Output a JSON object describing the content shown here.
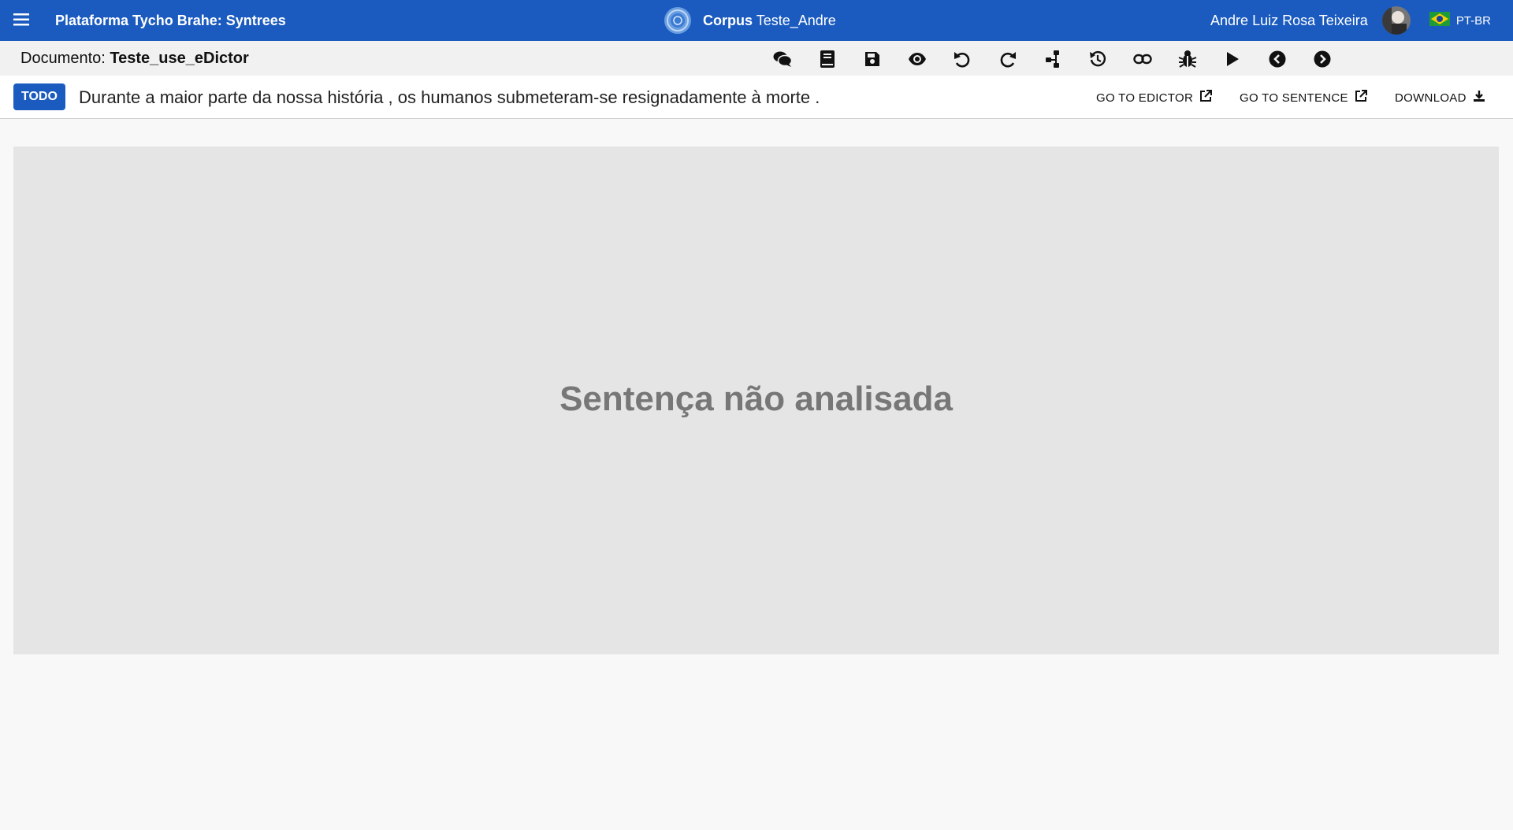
{
  "header": {
    "menu_icon": "hamburger-menu-icon",
    "app_title": "Plataforma Tycho Brahe: Syntrees",
    "corpus_label": "Corpus",
    "corpus_name": "Teste_Andre",
    "user_name": "Andre Luiz Rosa Teixeira",
    "language": "PT-BR",
    "brand_color": "#1b5bbf"
  },
  "document": {
    "label": "Documento:",
    "name": "Teste_use_eDictor"
  },
  "toolbar": {
    "icons": [
      "comments-icon",
      "book-icon",
      "save-icon",
      "eye-icon",
      "undo-icon",
      "redo-icon",
      "tree-icon",
      "history-icon",
      "link-icon",
      "bug-icon",
      "play-icon",
      "previous-icon",
      "next-icon"
    ]
  },
  "sentence": {
    "status": "TODO",
    "text": "Durante a maior parte da nossa história , os humanos submeteram-se resignadamente à morte .",
    "actions": {
      "go_to_edictor": "GO TO EDICTOR",
      "go_to_sentence": "GO TO SENTENCE",
      "download": "DOWNLOAD"
    }
  },
  "canvas": {
    "message": "Sentença não analisada"
  }
}
